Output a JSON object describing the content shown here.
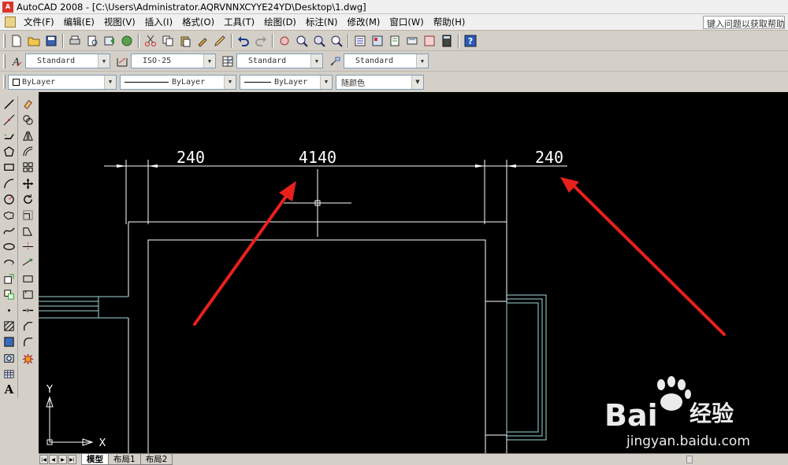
{
  "window": {
    "app_icon_text": "A",
    "title": "AutoCAD 2008 - [C:\\Users\\Administrator.AQRVNNXCYYE24YD\\Desktop\\1.dwg]"
  },
  "menubar": {
    "items": [
      "文件(F)",
      "编辑(E)",
      "视图(V)",
      "插入(I)",
      "格式(O)",
      "工具(T)",
      "绘图(D)",
      "标注(N)",
      "修改(M)",
      "窗口(W)",
      "帮助(H)"
    ],
    "help_box": "键入问题以获取帮助"
  },
  "styles_toolbar": {
    "text_style": "Standard",
    "dim_style": "ISO-25",
    "table_style": "Standard",
    "multileader_style": "Standard"
  },
  "properties_toolbar": {
    "layer": "ByLayer",
    "linetype": "ByLayer",
    "lineweight": "ByLayer",
    "color": "随颜色"
  },
  "left_tools": {
    "draw_text_tool": "A"
  },
  "drawing": {
    "dim_left": "240",
    "dim_center": "4140",
    "dim_right": "240",
    "ucs_y": "Y",
    "ucs_x": "X",
    "colors": {
      "background": "#000000",
      "geometry": "#ffffff",
      "cyan_lines": "#9fd8d8",
      "arrow": "#e8201c"
    }
  },
  "layout_tabs": [
    "模型",
    "布局1",
    "布局2"
  ],
  "watermark": {
    "brand": "Bai",
    "brand2": "经验",
    "url": "jingyan.baidu.com"
  }
}
